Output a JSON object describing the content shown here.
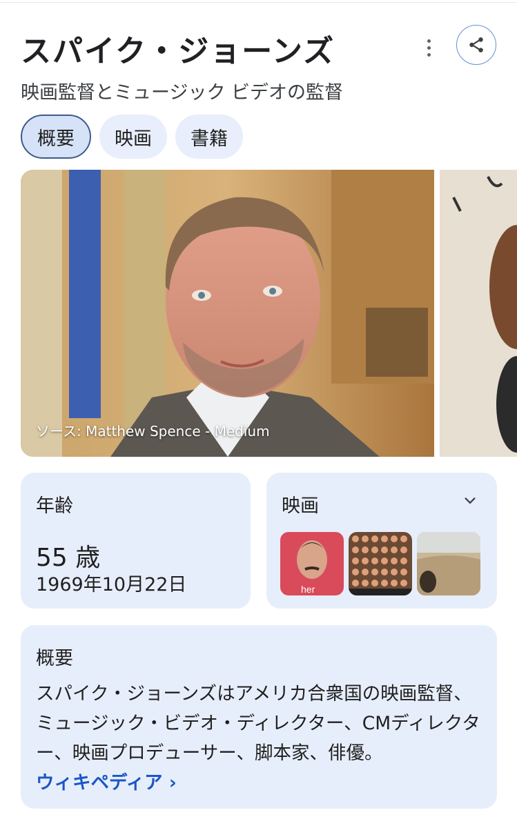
{
  "header": {
    "title": "スパイク・ジョーンズ",
    "subtitle": "映画監督とミュージック ビデオの監督",
    "more_icon": "more-vert-icon",
    "share_icon": "share-icon"
  },
  "tabs": [
    {
      "label": "概要",
      "active": true
    },
    {
      "label": "映画",
      "active": false
    },
    {
      "label": "書籍",
      "active": false
    }
  ],
  "photo": {
    "caption": "ソース: Matthew Spence - Medium"
  },
  "age_card": {
    "title": "年齢",
    "value": "55 歳",
    "birth_date": "1969年10月22日"
  },
  "films_card": {
    "title": "映画",
    "expand_icon": "chevron-down-icon",
    "thumbnails": [
      "her",
      "",
      ""
    ]
  },
  "overview": {
    "title": "概要",
    "text": "スパイク・ジョーンズはアメリカ合衆国の映画監督、ミュージック・ビデオ・ディレクター、CMディレクター、映画プロデューサー、脚本家、俳優。",
    "link_label": "ウィキペディア ›"
  },
  "colors": {
    "accent": "#1a56c8",
    "card_bg": "#e7eefb",
    "active_tab_border": "#3c5a8a"
  }
}
